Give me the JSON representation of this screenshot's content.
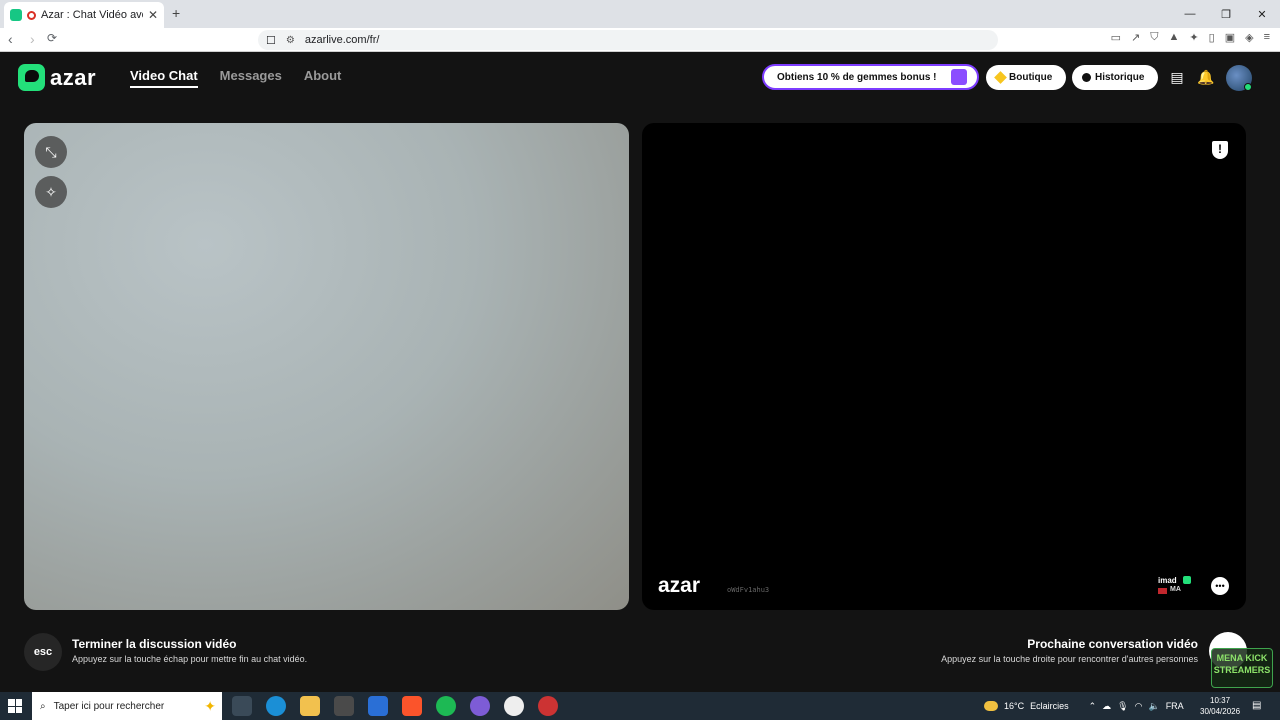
{
  "browser": {
    "tab_title": "Azar : Chat Vidéo avec de no",
    "tab_close": "✕",
    "new_tab": "+",
    "url": "azarlive.com/fr/",
    "window_controls": [
      "—",
      "❐",
      "✕"
    ]
  },
  "header": {
    "logo_text": "azar",
    "nav": [
      "Video Chat",
      "Messages",
      "About"
    ],
    "active_nav": "Video Chat",
    "promo": "Obtiens 10 % de gemmes bonus !",
    "shop": "Boutique",
    "history": "Historique"
  },
  "remote": {
    "watermark": "azar",
    "watermark_id": "oWdFv1ahu3",
    "peer_name": "imad",
    "peer_country": "MA",
    "report_icon": "!"
  },
  "controls": {
    "esc_key": "esc",
    "end_title": "Terminer la discussion vidéo",
    "end_subtitle": "Appuyez sur la touche échap pour mettre fin au chat vidéo.",
    "next_title": "Prochaine conversation vidéo",
    "next_subtitle": "Appuyez sur la touche droite pour rencontrer d'autres personnes"
  },
  "overlay": {
    "line1": "MENA KICK",
    "line2": "STREAMERS"
  },
  "taskbar": {
    "search_placeholder": "Taper ici pour rechercher",
    "weather_temp": "16°C",
    "weather_text": "Eclaircies",
    "language": "FRA",
    "time": "10:37",
    "date": "30/04/2026"
  },
  "colors": {
    "brand": "#23e07a",
    "promo_border": "#7d3cff",
    "page_bg": "#131313"
  }
}
